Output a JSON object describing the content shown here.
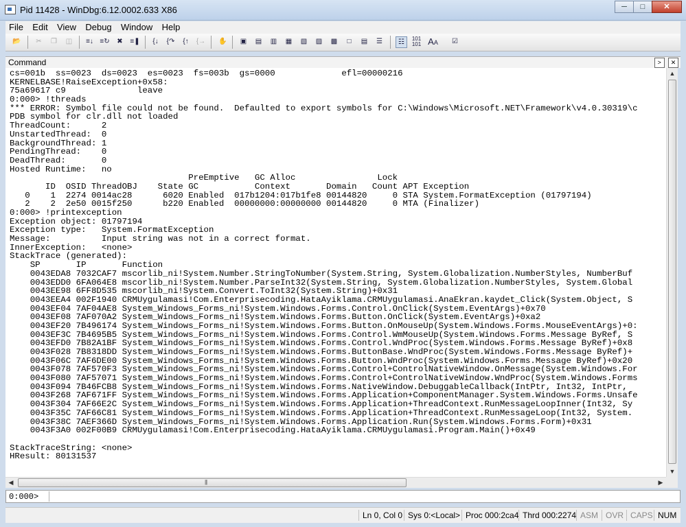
{
  "window": {
    "title": "Pid 11428 - WinDbg:6.12.0002.633 X86"
  },
  "menu": [
    "File",
    "Edit",
    "View",
    "Debug",
    "Window",
    "Help"
  ],
  "panel": {
    "title": "Command"
  },
  "output_lines": [
    "cs=001b  ss=0023  ds=0023  es=0023  fs=003b  gs=0000             efl=00000216",
    "KERNELBASE!RaiseException+0x58:",
    "75a69617 c9              leave",
    "0:000> !threads",
    "*** ERROR: Symbol file could not be found.  Defaulted to export symbols for C:\\Windows\\Microsoft.NET\\Framework\\v4.0.30319\\c",
    "PDB symbol for clr.dll not loaded",
    "ThreadCount:      2",
    "UnstartedThread:  0",
    "BackgroundThread: 1",
    "PendingThread:    0",
    "DeadThread:       0",
    "Hosted Runtime:   no",
    "                                   PreEmptive   GC Alloc                Lock",
    "       ID  OSID ThreadOBJ    State GC           Context       Domain   Count APT Exception",
    "   0    1  2274 0014ac28      6020 Enabled  017b1204:017b1fe8 00144820     0 STA System.FormatException (01797194)",
    "   2    2  2e50 0015f250      b220 Enabled  00000000:00000000 00144820     0 MTA (Finalizer)",
    "0:000> !printexception",
    "Exception object: 01797194",
    "Exception type:   System.FormatException",
    "Message:          Input string was not in a correct format.",
    "InnerException:   <none>",
    "StackTrace (generated):",
    "    SP       IP       Function",
    "    0043EDA8 7032CAF7 mscorlib_ni!System.Number.StringToNumber(System.String, System.Globalization.NumberStyles, NumberBuf",
    "    0043EDD0 6FA064E8 mscorlib_ni!System.Number.ParseInt32(System.String, System.Globalization.NumberStyles, System.Global",
    "    0043EE98 6FF8D535 mscorlib_ni!System.Convert.ToInt32(System.String)+0x31",
    "    0043EEA4 002F1940 CRMUygulamasi!Com.Enterprisecoding.HataAyiklama.CRMUygulamasi.AnaEkran.kaydet_Click(System.Object, S",
    "    0043EF04 7AF04AE8 System_Windows_Forms_ni!System.Windows.Forms.Control.OnClick(System.EventArgs)+0x70",
    "    0043EF08 7AF070A2 System_Windows_Forms_ni!System.Windows.Forms.Button.OnClick(System.EventArgs)+0xa2",
    "    0043EF20 7B496174 System_Windows_Forms_ni!System.Windows.Forms.Button.OnMouseUp(System.Windows.Forms.MouseEventArgs)+0:",
    "    0043EF3C 7B4695B5 System_Windows_Forms_ni!System.Windows.Forms.Control.WmMouseUp(System.Windows.Forms.Message ByRef, S",
    "    0043EFD0 7B82A1BF System_Windows_Forms_ni!System.Windows.Forms.Control.WndProc(System.Windows.Forms.Message ByRef)+0x8",
    "    0043F028 7B8318DD System_Windows_Forms_ni!System.Windows.Forms.ButtonBase.WndProc(System.Windows.Forms.Message ByRef)+",
    "    0043F06C 7AF6DE00 System_Windows_Forms_ni!System.Windows.Forms.Button.WndProc(System.Windows.Forms.Message ByRef)+0x20",
    "    0043F078 7AF570F3 System_Windows_Forms_ni!System.Windows.Forms.Control+ControlNativeWindow.OnMessage(System.Windows.For",
    "    0043F080 7AF57071 System_Windows_Forms_ni!System.Windows.Forms.Control+ControlNativeWindow.WndProc(System.Windows.Forms",
    "    0043F094 7B46FCB8 System_Windows_Forms_ni!System.Windows.Forms.NativeWindow.DebuggableCallback(IntPtr, Int32, IntPtr, ",
    "    0043F268 7AF671FF System_Windows_Forms_ni!System.Windows.Forms.Application+ComponentManager.System.Windows.Forms.Unsafe",
    "    0043F304 7AF66E2C System_Windows_Forms_ni!System.Windows.Forms.Application+ThreadContext.RunMessageLoopInner(Int32, Sy",
    "    0043F35C 7AF66C81 System_Windows_Forms_ni!System.Windows.Forms.Application+ThreadContext.RunMessageLoop(Int32, System.",
    "    0043F38C 7AEF366D System_Windows_Forms_ni!System.Windows.Forms.Application.Run(System.Windows.Forms.Form)+0x31",
    "    0043F3A0 002F00B9 CRMUygulamasi!Com.Enterprisecoding.HataAyiklama.CRMUygulamasi.Program.Main()+0x49",
    "",
    "StackTraceString: <none>",
    "HResult: 80131537"
  ],
  "input": {
    "prompt": "0:000>",
    "value": ""
  },
  "status": {
    "position": "Ln 0, Col 0",
    "system": "Sys 0:<Local>",
    "process": "Proc 000:2ca4",
    "thread": "Thrd 000:2274",
    "asm": "ASM",
    "ovr": "OVR",
    "caps": "CAPS",
    "num": "NUM"
  },
  "toolbar": [
    "open-icon",
    "cut-icon",
    "copy-icon",
    "paste-icon",
    "go-icon",
    "restart-icon",
    "stop-debugging-icon",
    "break-icon",
    "step-into-icon",
    "step-over-icon",
    "step-out-icon",
    "run-to-cursor-icon",
    "hand-icon",
    "command-window-icon",
    "watch-window-icon",
    "locals-window-icon",
    "registers-window-icon",
    "memory-window-icon",
    "call-stack-icon",
    "disassembly-icon",
    "scratch-pad-icon",
    "source-mode-icon",
    "hex-display-icon",
    "font-icon",
    "options-icon"
  ]
}
